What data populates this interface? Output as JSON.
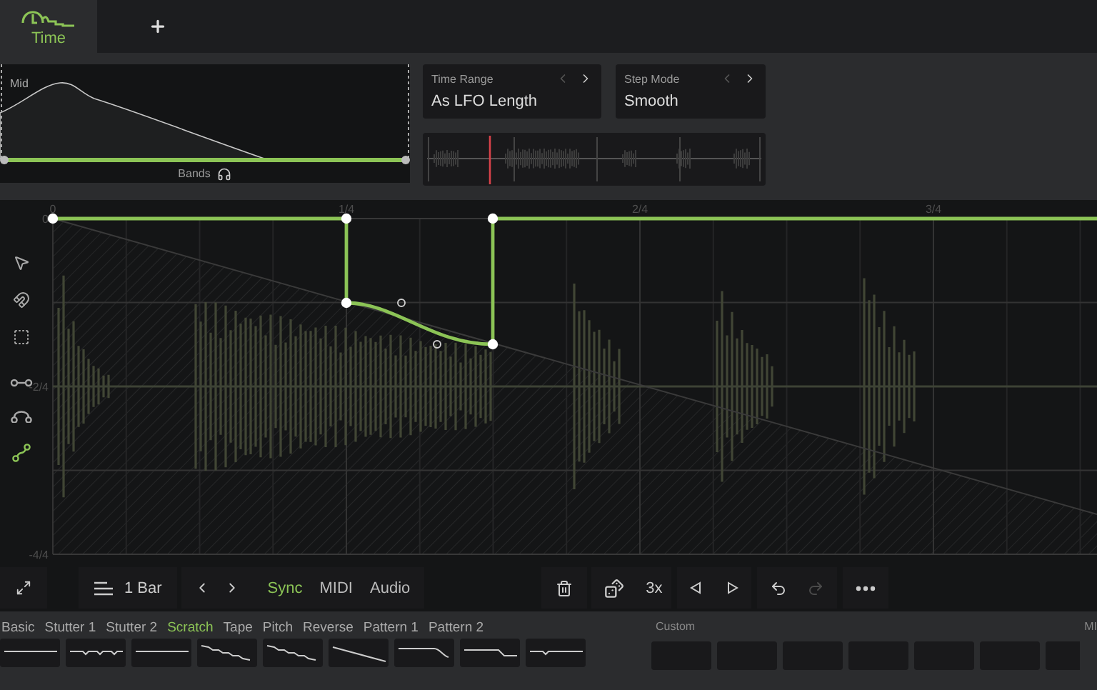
{
  "tabs": [
    {
      "label": "Time",
      "selected": true
    }
  ],
  "band_panel": {
    "label": "Mid",
    "footer": "Bands"
  },
  "selectors": [
    {
      "label": "Time Range",
      "value": "As LFO Length"
    },
    {
      "label": "Step Mode",
      "value": "Smooth"
    }
  ],
  "editor": {
    "x_labels": [
      "0",
      "1/4",
      "2/4",
      "3/4"
    ],
    "y_labels": [
      "0",
      "-2/4",
      "-4/4"
    ],
    "tool_groups": [
      {
        "tools": [
          {
            "kind": "pointer",
            "selected": false
          },
          {
            "kind": "magnet",
            "selected": false
          },
          {
            "kind": "select",
            "selected": false
          }
        ]
      },
      {
        "tools": [
          {
            "kind": "line",
            "selected": false
          },
          {
            "kind": "arc",
            "selected": false
          },
          {
            "kind": "curve",
            "selected": true
          }
        ]
      }
    ]
  },
  "toolbar": {
    "grid": "1 Bar",
    "modes": [
      {
        "label": "Sync",
        "selected": true
      },
      {
        "label": "MIDI",
        "selected": false
      },
      {
        "label": "Audio",
        "selected": false
      }
    ],
    "repeat": "3x",
    "redo_disabled": true
  },
  "presets": [
    {
      "label": "Basic",
      "kind": "flat",
      "selected": false
    },
    {
      "label": "Stutter 1",
      "kind": "notched",
      "selected": false
    },
    {
      "label": "Stutter 2",
      "kind": "flat",
      "selected": false
    },
    {
      "label": "Scratch",
      "kind": "wavy",
      "selected": true
    },
    {
      "label": "Tape",
      "kind": "wavy",
      "selected": false
    },
    {
      "label": "Pitch",
      "kind": "line",
      "selected": false
    },
    {
      "label": "Reverse",
      "kind": "drop",
      "selected": false
    },
    {
      "label": "Pattern 1",
      "kind": "step",
      "selected": false
    },
    {
      "label": "Pattern 2",
      "kind": "dip",
      "selected": false
    }
  ],
  "custom": {
    "label": "Custom"
  },
  "next_section": "MI"
}
